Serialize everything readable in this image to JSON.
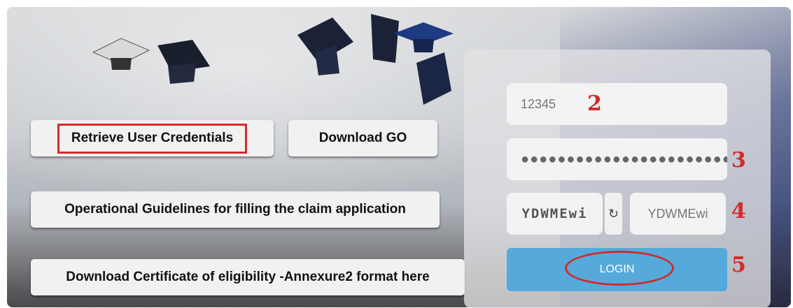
{
  "buttons": {
    "retrieve": "Retrieve User Credentials",
    "download_go": "Download GO",
    "guidelines": "Operational Guidelines for filling the claim application",
    "certificate": "Download Certificate of eligibility -Annexure2 format here"
  },
  "login_form": {
    "username_value": "12345",
    "password_value": "●●●●●●●●●●●●●●●●●●●●●●●",
    "captcha_text": "YDWMEwi",
    "captcha_input_placeholder": "YDWMEwi",
    "login_label": "LOGIN",
    "refresh_icon": "refresh-icon"
  },
  "annotations": {
    "n2": "2",
    "n3": "3",
    "n4": "4",
    "n5": "5"
  },
  "colors": {
    "annotation_red": "#d22b2b",
    "login_blue": "#55aadb"
  }
}
